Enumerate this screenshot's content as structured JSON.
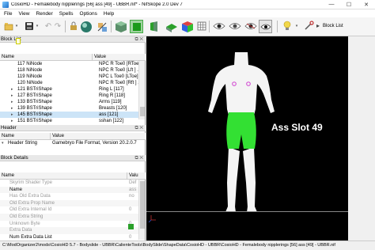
{
  "window": {
    "title": "CosioHD - Femalebody nipplerings [56] ass [49] - UBBR.nif* - NifSkope 2.0 Dev 7",
    "minimize": "—",
    "maximize": "☐",
    "close": "✕"
  },
  "menu": [
    "File",
    "View",
    "Render",
    "Spells",
    "Options",
    "Help"
  ],
  "toolbar": {
    "block_list": "Block List"
  },
  "block_list": {
    "title": "Block List",
    "col_name": "Name",
    "col_value": "Value",
    "rows": [
      {
        "name": "117 NiNode",
        "value": "NPC R Toe0 [RToe..."
      },
      {
        "name": "118 NiNode",
        "value": "NPC R Toe0 [Lft ] ..."
      },
      {
        "name": "119 NiNode",
        "value": "NPC L Toe0 [LToe]..."
      },
      {
        "name": "120 NiNode",
        "value": "NPC R Toe0 [Rft ] ..."
      },
      {
        "name": "121 BSTriShape",
        "value": "Ring L [117]"
      },
      {
        "name": "127 BSTriShape",
        "value": "Ring R [118]"
      },
      {
        "name": "133 BSTriShape",
        "value": "Arms [119]"
      },
      {
        "name": "139 BSTriShape",
        "value": "Breasts [120]"
      },
      {
        "name": "145 BSTriShape",
        "value": "ass [121]"
      },
      {
        "name": "151 BSTriShape",
        "value": "sshan [122]"
      }
    ]
  },
  "header": {
    "title": "Header",
    "col_name": "Name",
    "col_value": "Value",
    "row_name": "Header String",
    "row_value": "Gamebryo File Format, Version 20.2.0.7"
  },
  "block_details": {
    "title": "Block Details",
    "col_name": "Name",
    "col_value": "Valu",
    "rows": [
      {
        "name": "Skyrim Shader Type",
        "value": "Def",
        "dark": false
      },
      {
        "name": "Name",
        "value": "ass",
        "dark": true
      },
      {
        "name": "Has Old Extra Data",
        "value": "no",
        "dark": false
      },
      {
        "name": "Old Extra Prop Name",
        "value": "",
        "dark": false
      },
      {
        "name": "Old Extra Internal Id",
        "value": "0",
        "dark": false
      },
      {
        "name": "Old Extra String",
        "value": "",
        "dark": false
      },
      {
        "name": "Unknown Byte",
        "value": "0",
        "dark": false
      },
      {
        "name": "Extra Data",
        "value": "",
        "dark": false
      },
      {
        "name": "Num Extra Data List",
        "value": "0",
        "dark": true
      }
    ]
  },
  "viewport": {
    "label": "Ass Slot 49"
  },
  "status": "C:\\ModOrganizer2\\mods\\CosioHD 5.7 - Bodyslide - UBBR\\CalienteTools\\BodySlide\\ShapeData\\CosioHD - UBBR\\CosioHD - Femalebody nipplerings [56] ass [49] - UBBR.nif",
  "colors": {
    "highlight": "#33e033",
    "selection": "#cce4f7",
    "viewport_bg": "#000000",
    "skin": "#f4f4f4"
  }
}
